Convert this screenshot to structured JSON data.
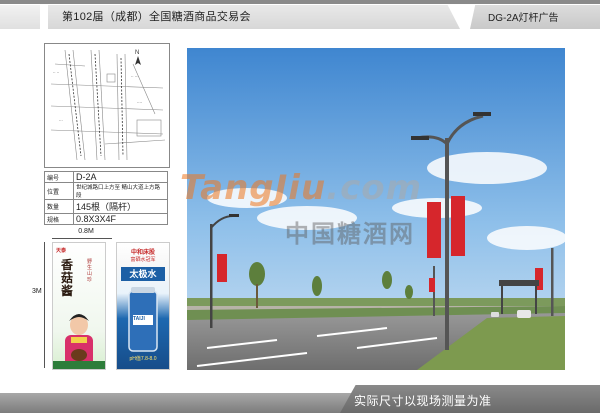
{
  "header": {
    "title": "第102届（成都）全国糖酒商品交易会",
    "code": "DG-2A灯杆广告"
  },
  "map": {
    "north_label": "N"
  },
  "info": {
    "rows": [
      {
        "key": "编号",
        "value": "D-2A"
      },
      {
        "key": "位置",
        "value": "世纪城路口上方至 鲭山大道上方路段"
      },
      {
        "key": "数量",
        "value": "145根（隔杆）"
      },
      {
        "key": "规格",
        "value": "0.8X3X4F"
      }
    ]
  },
  "poster_dims": {
    "width": "0.8M",
    "height": "3M"
  },
  "poster1": {
    "brand": "天泰",
    "headline": "香菇酱",
    "slogan": "野生 山珍"
  },
  "poster2": {
    "top_text": "中和床股",
    "sub_text": "富硒水冠军",
    "product": "太极水",
    "can_text": "TAIJI",
    "ph": "pH值7.8-8.0"
  },
  "watermark": {
    "en_orange": "Tang",
    "en_orange2": "Jiu",
    "en_gray": ".com",
    "cn": "中国糖酒网"
  },
  "footer": {
    "note": "实际尺寸以现场测量为准"
  },
  "colors": {
    "banner_red": "#d6262c",
    "sky_top": "#3f86d0",
    "accent_orange": "#ee761e"
  }
}
